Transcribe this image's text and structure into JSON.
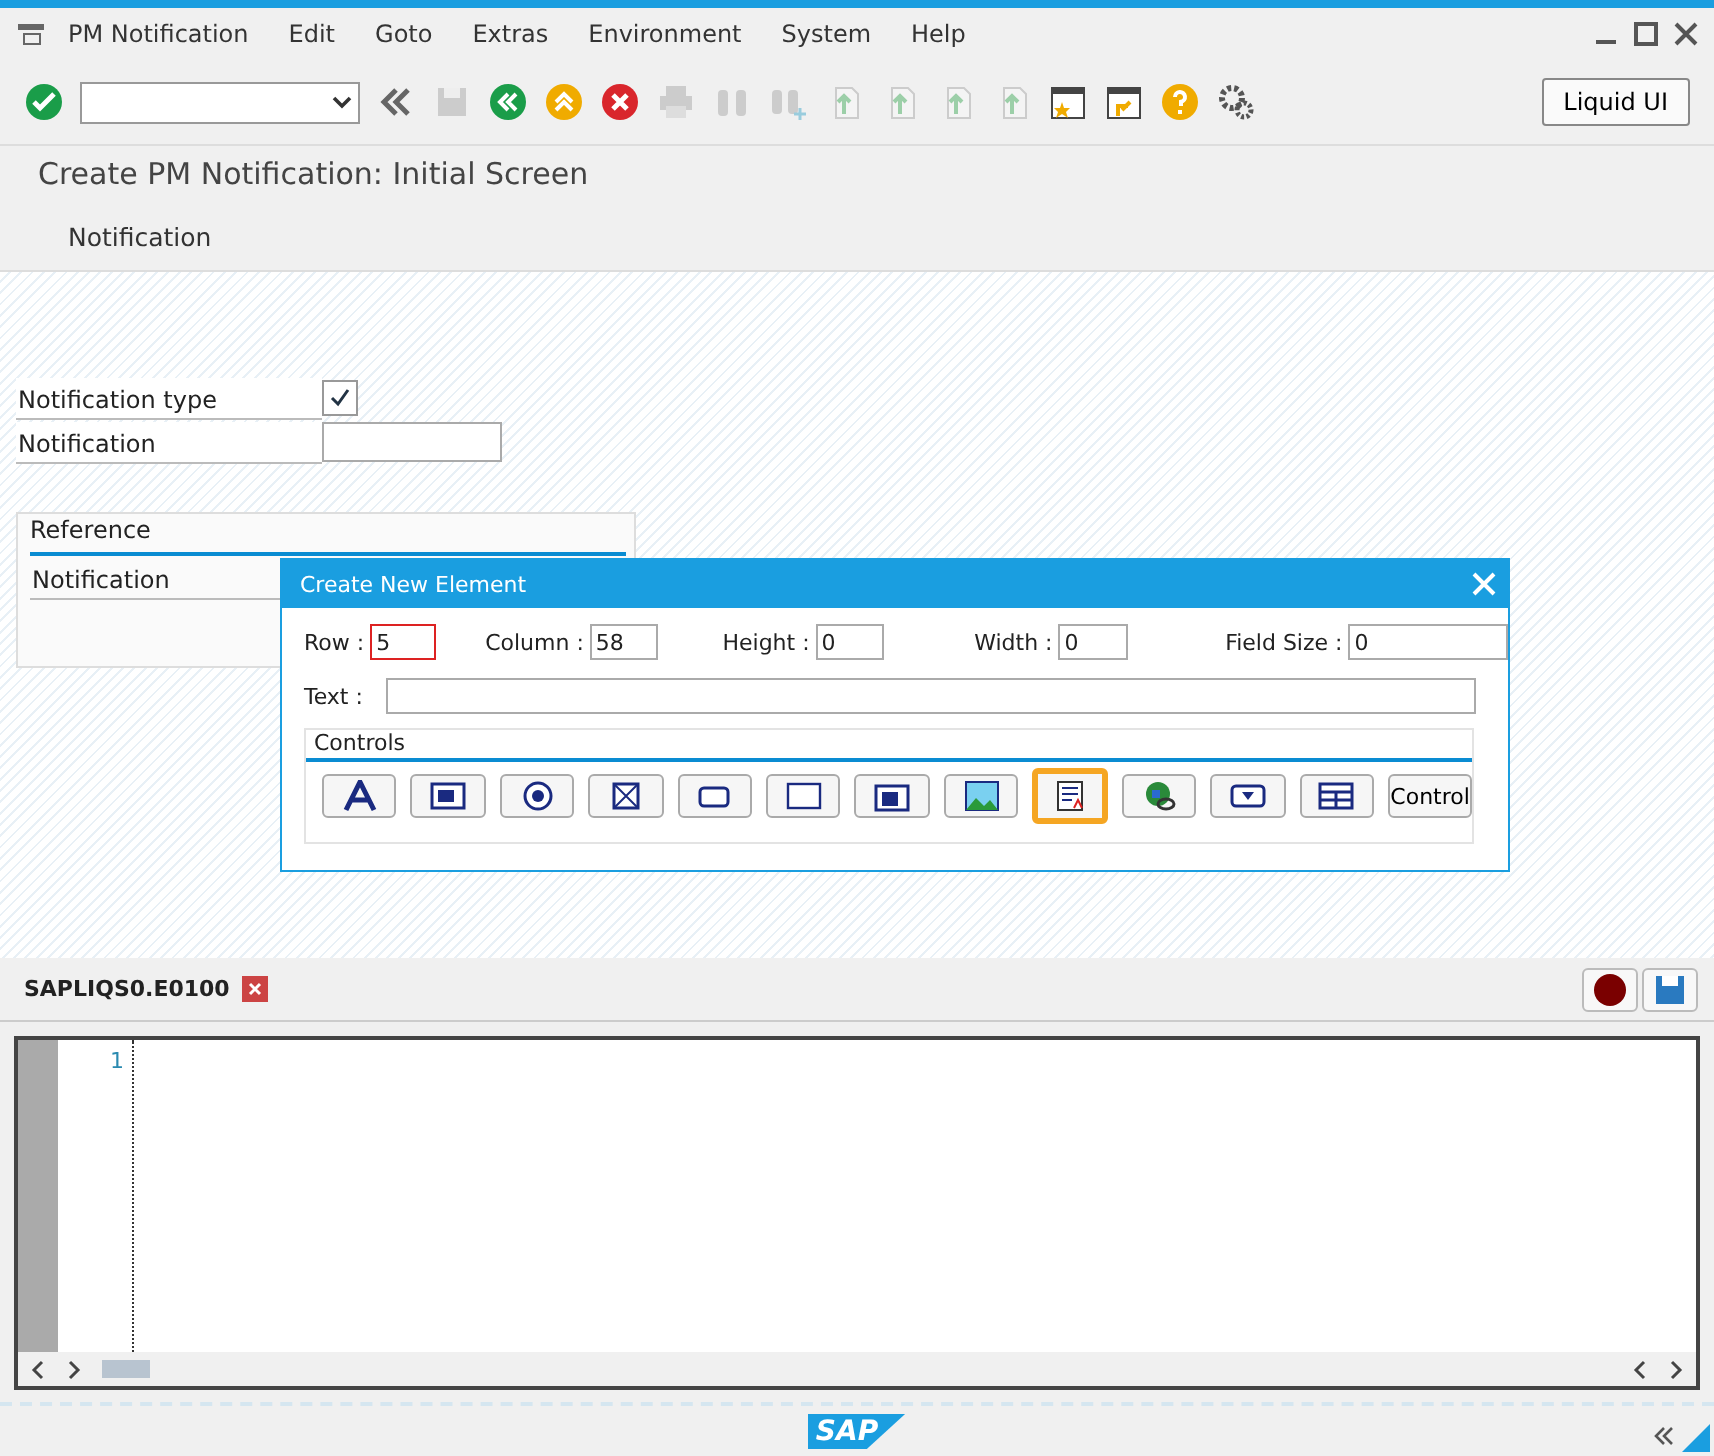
{
  "menu_bar": {
    "items": [
      "PM Notification",
      "Edit",
      "Goto",
      "Extras",
      "Environment",
      "System",
      "Help"
    ]
  },
  "toolbar": {
    "liquid_ui_button": "Liquid UI"
  },
  "screen_title": "Create PM Notification: Initial Screen",
  "app_toolbar": {
    "items": [
      "Notification"
    ]
  },
  "form": {
    "fields": [
      {
        "label": "Notification type",
        "kind": "checkbox",
        "checked": true
      },
      {
        "label": "Notification",
        "kind": "input"
      }
    ],
    "reference_group": {
      "title": "Reference",
      "fields": [
        {
          "label": "Notification"
        }
      ]
    }
  },
  "dialog": {
    "title": "Create New Element",
    "fields": [
      {
        "label": "Row :",
        "value": "5",
        "focused": true
      },
      {
        "label": "Column :",
        "value": "58",
        "focused": false
      },
      {
        "label": "Height :",
        "value": "0",
        "focused": false
      },
      {
        "label": "Width :",
        "value": "0",
        "focused": false
      },
      {
        "label": "Field Size :",
        "value": "0",
        "focused": false
      }
    ],
    "text_field": {
      "label": "Text :"
    },
    "controls_group": {
      "title": "Controls",
      "items": [
        {
          "kind": "icon",
          "selected": false
        },
        {
          "kind": "icon",
          "selected": false
        },
        {
          "kind": "icon",
          "selected": false
        },
        {
          "kind": "icon",
          "selected": false
        },
        {
          "kind": "icon",
          "selected": false
        },
        {
          "kind": "icon",
          "selected": false
        },
        {
          "kind": "icon",
          "selected": false
        },
        {
          "kind": "icon",
          "selected": false
        },
        {
          "kind": "icon",
          "selected": true
        },
        {
          "kind": "icon",
          "selected": false
        },
        {
          "kind": "icon",
          "selected": false
        },
        {
          "kind": "icon",
          "selected": false
        },
        {
          "kind": "text",
          "label": "Control",
          "selected": false
        }
      ]
    }
  },
  "editor": {
    "tab": {
      "label": "SAPLIQS0.E0100"
    },
    "line_numbers": [
      "1"
    ]
  },
  "footer": {
    "logo_text": "SAP"
  }
}
